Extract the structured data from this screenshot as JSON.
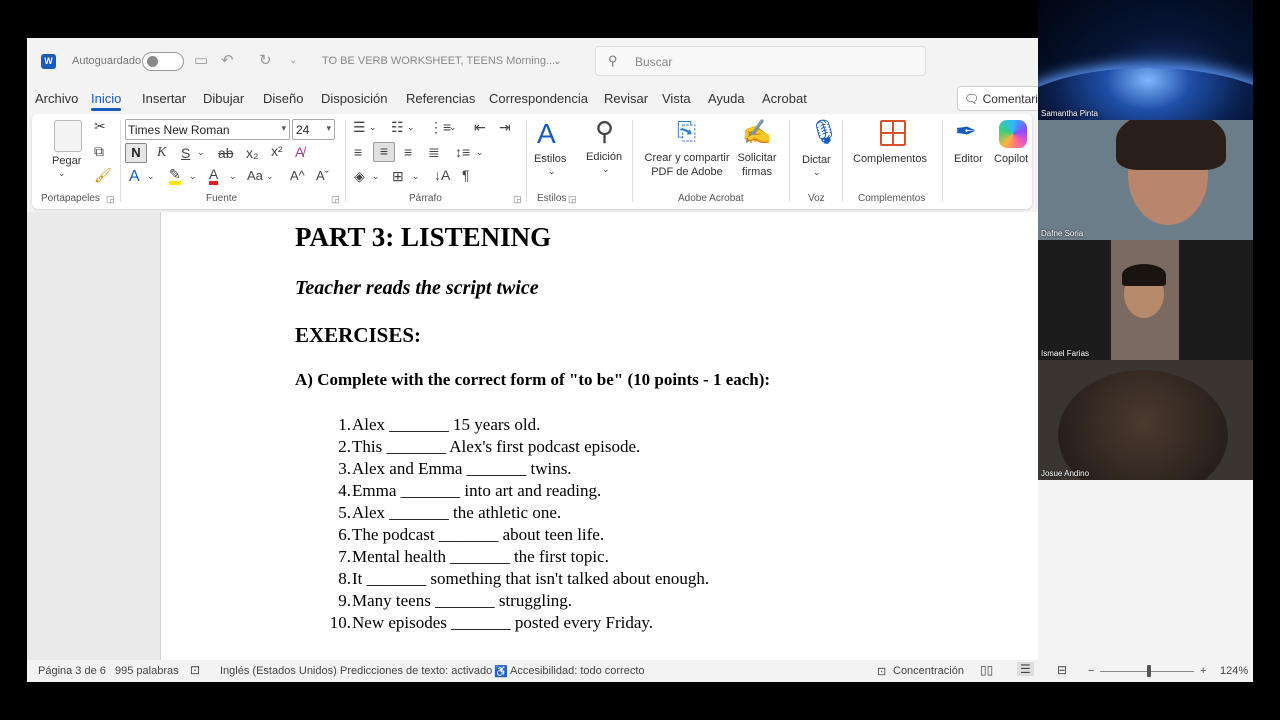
{
  "titlebar": {
    "autosave_label": "Autoguardado",
    "doc_title": "TO BE VERB WORKSHEET, TEENS Morning....",
    "search_placeholder": "Buscar"
  },
  "menu": {
    "tabs": [
      "Archivo",
      "Inicio",
      "Insertar",
      "Dibujar",
      "Diseño",
      "Disposición",
      "Referencias",
      "Correspondencia",
      "Revisar",
      "Vista",
      "Ayuda",
      "Acrobat"
    ],
    "active_tab": "Inicio",
    "comment_label": "Comentario"
  },
  "ribbon": {
    "font_name": "Times New Roman",
    "font_size": "24",
    "paste_label": "Pegar",
    "styles_label": "Estilos",
    "editing_label": "Edición",
    "acrobat_create_label": "Crear y compartir PDF de Adobe",
    "acrobat_sign_label": "Solicitar firmas",
    "dictate_label": "Dictar",
    "addins_label": "Complementos",
    "editor_label": "Editor",
    "copilot_label": "Copilot",
    "groups": {
      "clipboard": "Portapapeles",
      "font": "Fuente",
      "paragraph": "Párrafo",
      "styles": "Estilos",
      "acrobat": "Adobe Acrobat",
      "voice": "Voz",
      "addins": "Complementos"
    }
  },
  "document": {
    "heading": "PART 3: LISTENING",
    "subheading": "Teacher reads the script twice",
    "section": "EXERCISES:",
    "instruction": "A) Complete with the correct form of \"to be\" (10 points - 1 each):",
    "items": [
      {
        "n": "1.",
        "text": "Alex _______ 15 years old."
      },
      {
        "n": "2.",
        "text": "This _______ Alex's first podcast episode."
      },
      {
        "n": "3.",
        "text": "Alex and Emma _______ twins."
      },
      {
        "n": "4.",
        "text": "Emma _______ into art and reading."
      },
      {
        "n": "5.",
        "text": "Alex _______ the athletic one."
      },
      {
        "n": "6.",
        "text": "The podcast _______ about teen life."
      },
      {
        "n": "7.",
        "text": "Mental health _______ the first topic."
      },
      {
        "n": "8.",
        "text": "It _______ something that isn't talked about enough."
      },
      {
        "n": "9.",
        "text": "Many teens _______ struggling."
      },
      {
        "n": "10.",
        "text": "New episodes _______ posted every Friday."
      }
    ]
  },
  "statusbar": {
    "page": "Página 3 de 6",
    "words": "995 palabras",
    "language": "Inglés (Estados Unidos)",
    "predictions": "Predicciones de texto: activado",
    "accessibility": "Accesibilidad: todo correcto",
    "focus": "Concentración",
    "zoom": "124%"
  },
  "participants": [
    {
      "name": "Samantha Pinta"
    },
    {
      "name": "Dafne Soria"
    },
    {
      "name": "Ismael Farias"
    },
    {
      "name": "Josue Andino"
    }
  ],
  "colors": {
    "accent": "#185abd"
  }
}
